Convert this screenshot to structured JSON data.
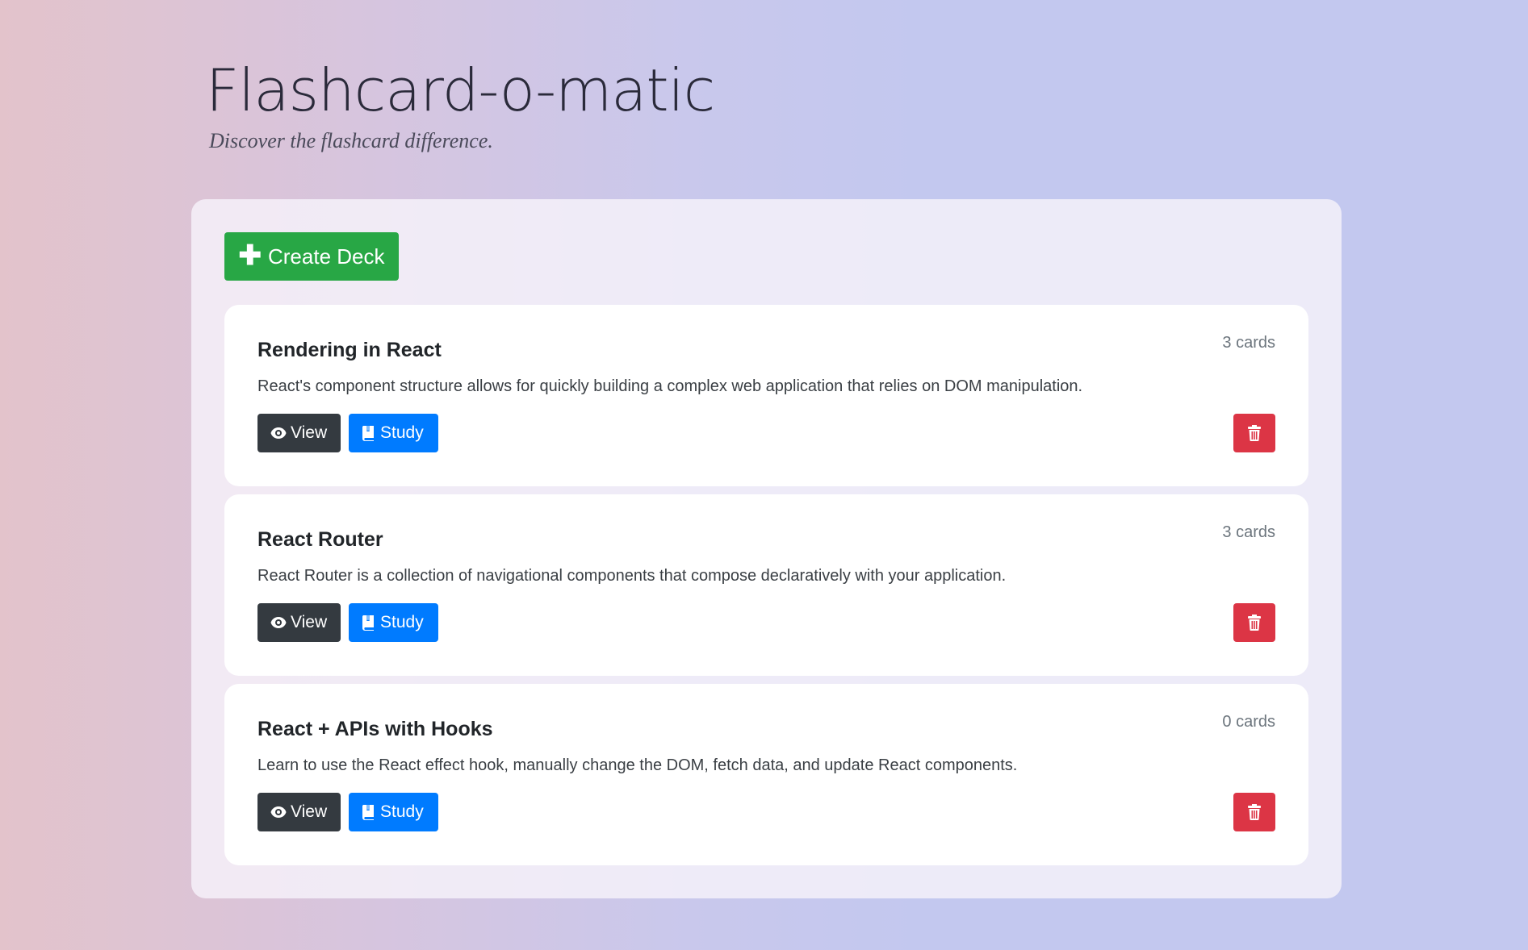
{
  "header": {
    "title": "Flashcard-o-matic",
    "subtitle": "Discover the flashcard difference."
  },
  "toolbar": {
    "create_label": "Create Deck",
    "create_icon": "plus-icon"
  },
  "decks": [
    {
      "title": "Rendering in React",
      "count": "3 cards",
      "description": "React's component structure allows for quickly building a complex web application that relies on DOM manipulation.",
      "view_label": "View",
      "study_label": "Study"
    },
    {
      "title": "React Router",
      "count": "3 cards",
      "description": "React Router is a collection of navigational components that compose declaratively with your application.",
      "view_label": "View",
      "study_label": "Study"
    },
    {
      "title": "React + APIs with Hooks",
      "count": "0 cards",
      "description": "Learn to use the React effect hook, manually change the DOM, fetch data, and update React components.",
      "view_label": "View",
      "study_label": "Study"
    }
  ],
  "icons": {
    "view": "eye-icon",
    "study": "book-icon",
    "delete": "trash-icon"
  },
  "colors": {
    "create": "#28a745",
    "view": "#343a40",
    "study": "#007bff",
    "delete": "#dc3545"
  }
}
